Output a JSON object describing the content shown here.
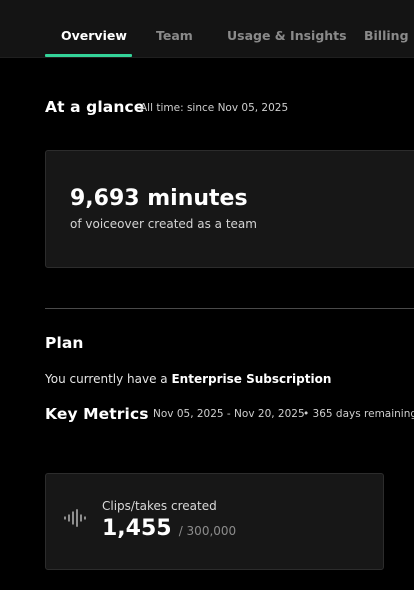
{
  "tabs": [
    {
      "label": "Overview",
      "active": true
    },
    {
      "label": "Team",
      "active": false
    },
    {
      "label": "Usage & Insights",
      "active": false
    },
    {
      "label": "Billing",
      "active": false
    }
  ],
  "glance": {
    "title": "At a glance",
    "subtitle": "All time: since Nov 05, 2025",
    "value": "9,693 minutes",
    "caption": "of voiceover created as a team"
  },
  "plan": {
    "title": "Plan",
    "text_prefix": "You currently have a",
    "plan_name": "Enterprise Subscription"
  },
  "key_metrics": {
    "title": "Key Metrics",
    "date_range": "Nov 05, 2025 - Nov 20, 2025",
    "remaining": "• 365 days remaining",
    "metric": {
      "icon": "audio-wave-icon",
      "label": "Clips/takes created",
      "value": "1,455",
      "limit": "/ 300,000"
    }
  },
  "colors": {
    "accent": "#34d399",
    "background": "#000000",
    "card": "#171717"
  }
}
